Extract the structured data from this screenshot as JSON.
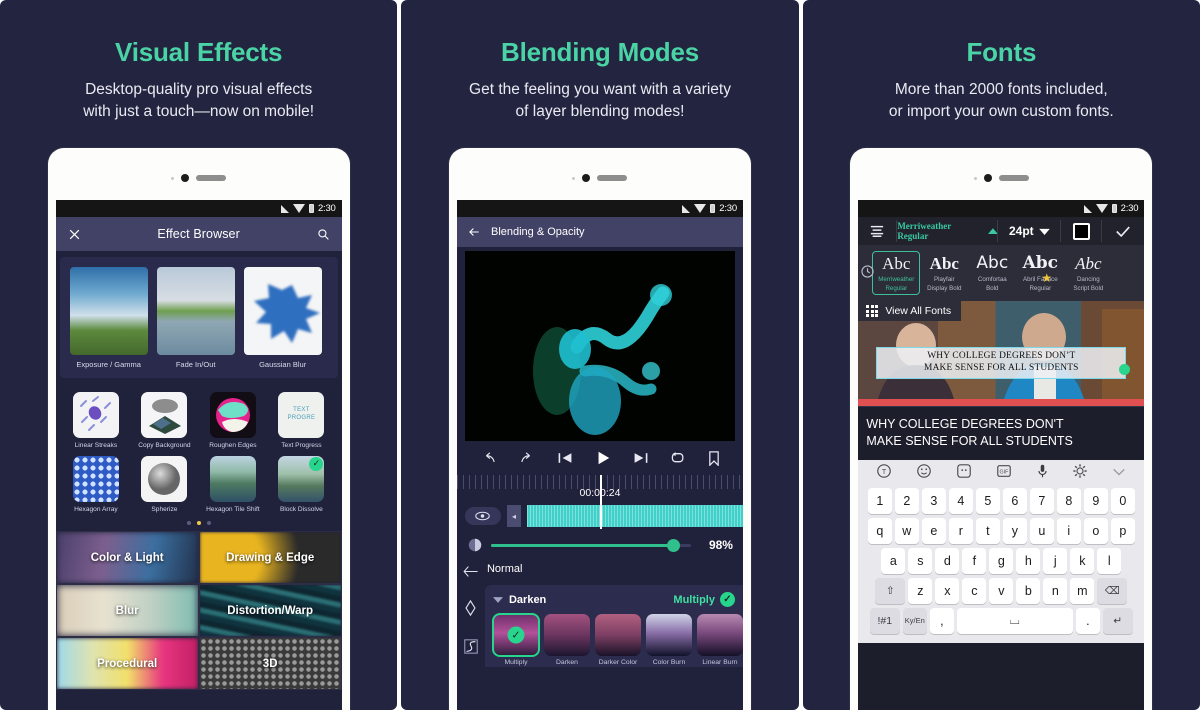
{
  "theme": {
    "bg": "#232440",
    "accent": "#4ad4a6",
    "panel_gap": "#ffffff"
  },
  "panels": [
    {
      "title": "Visual Effects",
      "subtitle_line1": "Desktop-quality pro visual effects",
      "subtitle_line2": "with just a touch—now on mobile!",
      "status": {
        "time": "2:30"
      },
      "appbar": {
        "close_label": "✕",
        "title": "Effect Browser",
        "search_label": "⌕"
      },
      "featured": [
        {
          "label": "Exposure / Gamma"
        },
        {
          "label": "Fade In/Out"
        },
        {
          "label": "Gaussian Blur"
        }
      ],
      "effects": [
        {
          "label": "Linear Streaks"
        },
        {
          "label": "Copy Background"
        },
        {
          "label": "Roughen Edges"
        },
        {
          "label": "Text Progress"
        },
        {
          "label": "Hexagon Array"
        },
        {
          "label": "Spherize"
        },
        {
          "label": "Hexagon Tile Shift"
        },
        {
          "label": "Block Dissolve"
        }
      ],
      "page_dots": {
        "count": 3,
        "active_index": 1
      },
      "categories": [
        "Color & Light",
        "Drawing & Edge",
        "Blur",
        "Distortion/Warp",
        "Procedural",
        "3D"
      ]
    },
    {
      "title": "Blending Modes",
      "subtitle_line1": "Get the feeling you want with a variety",
      "subtitle_line2": "of layer blending modes!",
      "status": {
        "time": "2:30"
      },
      "appbar": {
        "back_label": "←",
        "title": "Blending & Opacity"
      },
      "transport": [
        "undo",
        "redo",
        "skip-start",
        "play",
        "skip-end",
        "loop",
        "bookmark"
      ],
      "timecode": "00:00:24",
      "opacity": {
        "value": "98%",
        "percent": 98
      },
      "blend_current": "Normal",
      "blend_group": "Darken",
      "blend_selected": "Multiply",
      "blend_items": [
        {
          "label": "Multiply",
          "selected": true
        },
        {
          "label": "Darken",
          "selected": false
        },
        {
          "label": "Darker Color",
          "selected": false
        },
        {
          "label": "Color Burn",
          "selected": false
        },
        {
          "label": "Linear Burn",
          "selected": false
        }
      ]
    },
    {
      "title": "Fonts",
      "subtitle_line1": "More than 2000 fonts included,",
      "subtitle_line2": "or import your own custom fonts.",
      "status": {
        "time": "2:30"
      },
      "toolbar": {
        "font_name": "Merriweather Regular",
        "font_size": "24pt",
        "confirm_label": "✓"
      },
      "font_cards": [
        {
          "sample": "Abc",
          "name_line1": "Merriweather",
          "name_line2": "Regular",
          "selected": true,
          "starred": false
        },
        {
          "sample": "Abc",
          "name_line1": "Playfair",
          "name_line2": "Display Bold",
          "selected": false,
          "starred": false
        },
        {
          "sample": "Abc",
          "name_line1": "Comfortaa",
          "name_line2": "Bold",
          "selected": false,
          "starred": false
        },
        {
          "sample": "Abc",
          "name_line1": "Abril Fatface",
          "name_line2": "Regular",
          "selected": false,
          "starred": true
        },
        {
          "sample": "Abc",
          "name_line1": "Dancing",
          "name_line2": "Script Bold",
          "selected": false,
          "starred": false
        }
      ],
      "view_all_label": "View All Fonts",
      "overlay_text_line1": "WHY COLLEGE DEGREES DON’T",
      "overlay_text_line2": "MAKE SENSE FOR ALL STUDENTS",
      "caption_line1": "WHY COLLEGE DEGREES DON'T",
      "caption_line2": "MAKE SENSE FOR ALL STUDENTS",
      "keyboard": {
        "toolbar_icons": [
          "text-rotate-icon",
          "emoji-icon",
          "sticker-icon",
          "gif-icon",
          "mic-icon",
          "gear-icon",
          "chevron-down-icon"
        ],
        "row_numbers": [
          "1",
          "2",
          "3",
          "4",
          "5",
          "6",
          "7",
          "8",
          "9",
          "0"
        ],
        "row_q": [
          "q",
          "w",
          "e",
          "r",
          "t",
          "y",
          "u",
          "i",
          "o",
          "p"
        ],
        "row_a": [
          "a",
          "s",
          "d",
          "f",
          "g",
          "h",
          "j",
          "k",
          "l"
        ],
        "row_z": [
          "z",
          "x",
          "c",
          "v",
          "b",
          "n",
          "m"
        ],
        "shift_label": "⇧",
        "backspace_label": "⌫",
        "symbols_label": "!#1",
        "lang_label": "Ky/En",
        "comma_label": ",",
        "space_label": "⌴",
        "period_label": ".",
        "enter_label": "↵"
      }
    }
  ]
}
